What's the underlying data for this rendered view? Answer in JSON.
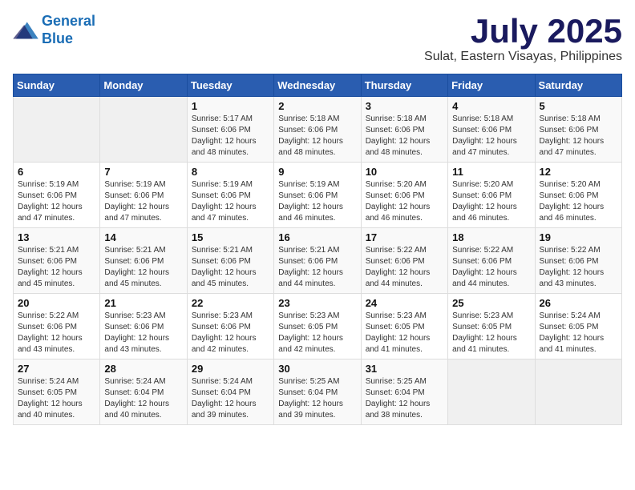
{
  "header": {
    "logo_line1": "General",
    "logo_line2": "Blue",
    "month_title": "July 2025",
    "location": "Sulat, Eastern Visayas, Philippines"
  },
  "weekdays": [
    "Sunday",
    "Monday",
    "Tuesday",
    "Wednesday",
    "Thursday",
    "Friday",
    "Saturday"
  ],
  "weeks": [
    [
      {
        "day": "",
        "info": ""
      },
      {
        "day": "",
        "info": ""
      },
      {
        "day": "1",
        "info": "Sunrise: 5:17 AM\nSunset: 6:06 PM\nDaylight: 12 hours and 48 minutes."
      },
      {
        "day": "2",
        "info": "Sunrise: 5:18 AM\nSunset: 6:06 PM\nDaylight: 12 hours and 48 minutes."
      },
      {
        "day": "3",
        "info": "Sunrise: 5:18 AM\nSunset: 6:06 PM\nDaylight: 12 hours and 48 minutes."
      },
      {
        "day": "4",
        "info": "Sunrise: 5:18 AM\nSunset: 6:06 PM\nDaylight: 12 hours and 47 minutes."
      },
      {
        "day": "5",
        "info": "Sunrise: 5:18 AM\nSunset: 6:06 PM\nDaylight: 12 hours and 47 minutes."
      }
    ],
    [
      {
        "day": "6",
        "info": "Sunrise: 5:19 AM\nSunset: 6:06 PM\nDaylight: 12 hours and 47 minutes."
      },
      {
        "day": "7",
        "info": "Sunrise: 5:19 AM\nSunset: 6:06 PM\nDaylight: 12 hours and 47 minutes."
      },
      {
        "day": "8",
        "info": "Sunrise: 5:19 AM\nSunset: 6:06 PM\nDaylight: 12 hours and 47 minutes."
      },
      {
        "day": "9",
        "info": "Sunrise: 5:19 AM\nSunset: 6:06 PM\nDaylight: 12 hours and 46 minutes."
      },
      {
        "day": "10",
        "info": "Sunrise: 5:20 AM\nSunset: 6:06 PM\nDaylight: 12 hours and 46 minutes."
      },
      {
        "day": "11",
        "info": "Sunrise: 5:20 AM\nSunset: 6:06 PM\nDaylight: 12 hours and 46 minutes."
      },
      {
        "day": "12",
        "info": "Sunrise: 5:20 AM\nSunset: 6:06 PM\nDaylight: 12 hours and 46 minutes."
      }
    ],
    [
      {
        "day": "13",
        "info": "Sunrise: 5:21 AM\nSunset: 6:06 PM\nDaylight: 12 hours and 45 minutes."
      },
      {
        "day": "14",
        "info": "Sunrise: 5:21 AM\nSunset: 6:06 PM\nDaylight: 12 hours and 45 minutes."
      },
      {
        "day": "15",
        "info": "Sunrise: 5:21 AM\nSunset: 6:06 PM\nDaylight: 12 hours and 45 minutes."
      },
      {
        "day": "16",
        "info": "Sunrise: 5:21 AM\nSunset: 6:06 PM\nDaylight: 12 hours and 44 minutes."
      },
      {
        "day": "17",
        "info": "Sunrise: 5:22 AM\nSunset: 6:06 PM\nDaylight: 12 hours and 44 minutes."
      },
      {
        "day": "18",
        "info": "Sunrise: 5:22 AM\nSunset: 6:06 PM\nDaylight: 12 hours and 44 minutes."
      },
      {
        "day": "19",
        "info": "Sunrise: 5:22 AM\nSunset: 6:06 PM\nDaylight: 12 hours and 43 minutes."
      }
    ],
    [
      {
        "day": "20",
        "info": "Sunrise: 5:22 AM\nSunset: 6:06 PM\nDaylight: 12 hours and 43 minutes."
      },
      {
        "day": "21",
        "info": "Sunrise: 5:23 AM\nSunset: 6:06 PM\nDaylight: 12 hours and 43 minutes."
      },
      {
        "day": "22",
        "info": "Sunrise: 5:23 AM\nSunset: 6:06 PM\nDaylight: 12 hours and 42 minutes."
      },
      {
        "day": "23",
        "info": "Sunrise: 5:23 AM\nSunset: 6:05 PM\nDaylight: 12 hours and 42 minutes."
      },
      {
        "day": "24",
        "info": "Sunrise: 5:23 AM\nSunset: 6:05 PM\nDaylight: 12 hours and 41 minutes."
      },
      {
        "day": "25",
        "info": "Sunrise: 5:23 AM\nSunset: 6:05 PM\nDaylight: 12 hours and 41 minutes."
      },
      {
        "day": "26",
        "info": "Sunrise: 5:24 AM\nSunset: 6:05 PM\nDaylight: 12 hours and 41 minutes."
      }
    ],
    [
      {
        "day": "27",
        "info": "Sunrise: 5:24 AM\nSunset: 6:05 PM\nDaylight: 12 hours and 40 minutes."
      },
      {
        "day": "28",
        "info": "Sunrise: 5:24 AM\nSunset: 6:04 PM\nDaylight: 12 hours and 40 minutes."
      },
      {
        "day": "29",
        "info": "Sunrise: 5:24 AM\nSunset: 6:04 PM\nDaylight: 12 hours and 39 minutes."
      },
      {
        "day": "30",
        "info": "Sunrise: 5:25 AM\nSunset: 6:04 PM\nDaylight: 12 hours and 39 minutes."
      },
      {
        "day": "31",
        "info": "Sunrise: 5:25 AM\nSunset: 6:04 PM\nDaylight: 12 hours and 38 minutes."
      },
      {
        "day": "",
        "info": ""
      },
      {
        "day": "",
        "info": ""
      }
    ]
  ]
}
